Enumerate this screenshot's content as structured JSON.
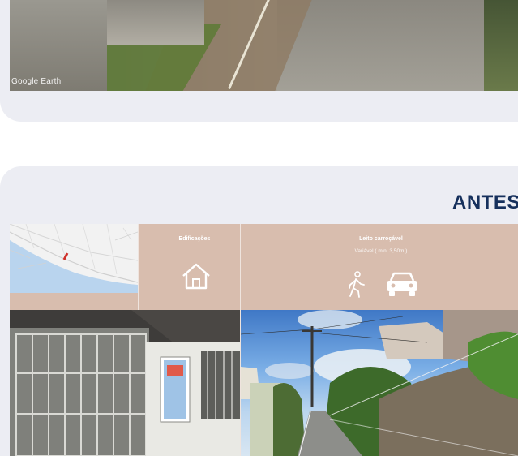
{
  "top_photo": {
    "watermark": "Google Earth"
  },
  "section": {
    "heading": "ANTES"
  },
  "columns": [
    {
      "title": "Edificações",
      "subtitle": "",
      "icons": [
        "house-icon"
      ]
    },
    {
      "title": "Leito carroçável",
      "subtitle": "Variável ( min. 3,50m )",
      "icons": [
        "pedestrian-icon",
        "car-icon"
      ]
    }
  ],
  "colors": {
    "heading": "#16305c",
    "band": "#d8bdae",
    "card": "#ecedf3",
    "map_marker": "#d0302a"
  }
}
